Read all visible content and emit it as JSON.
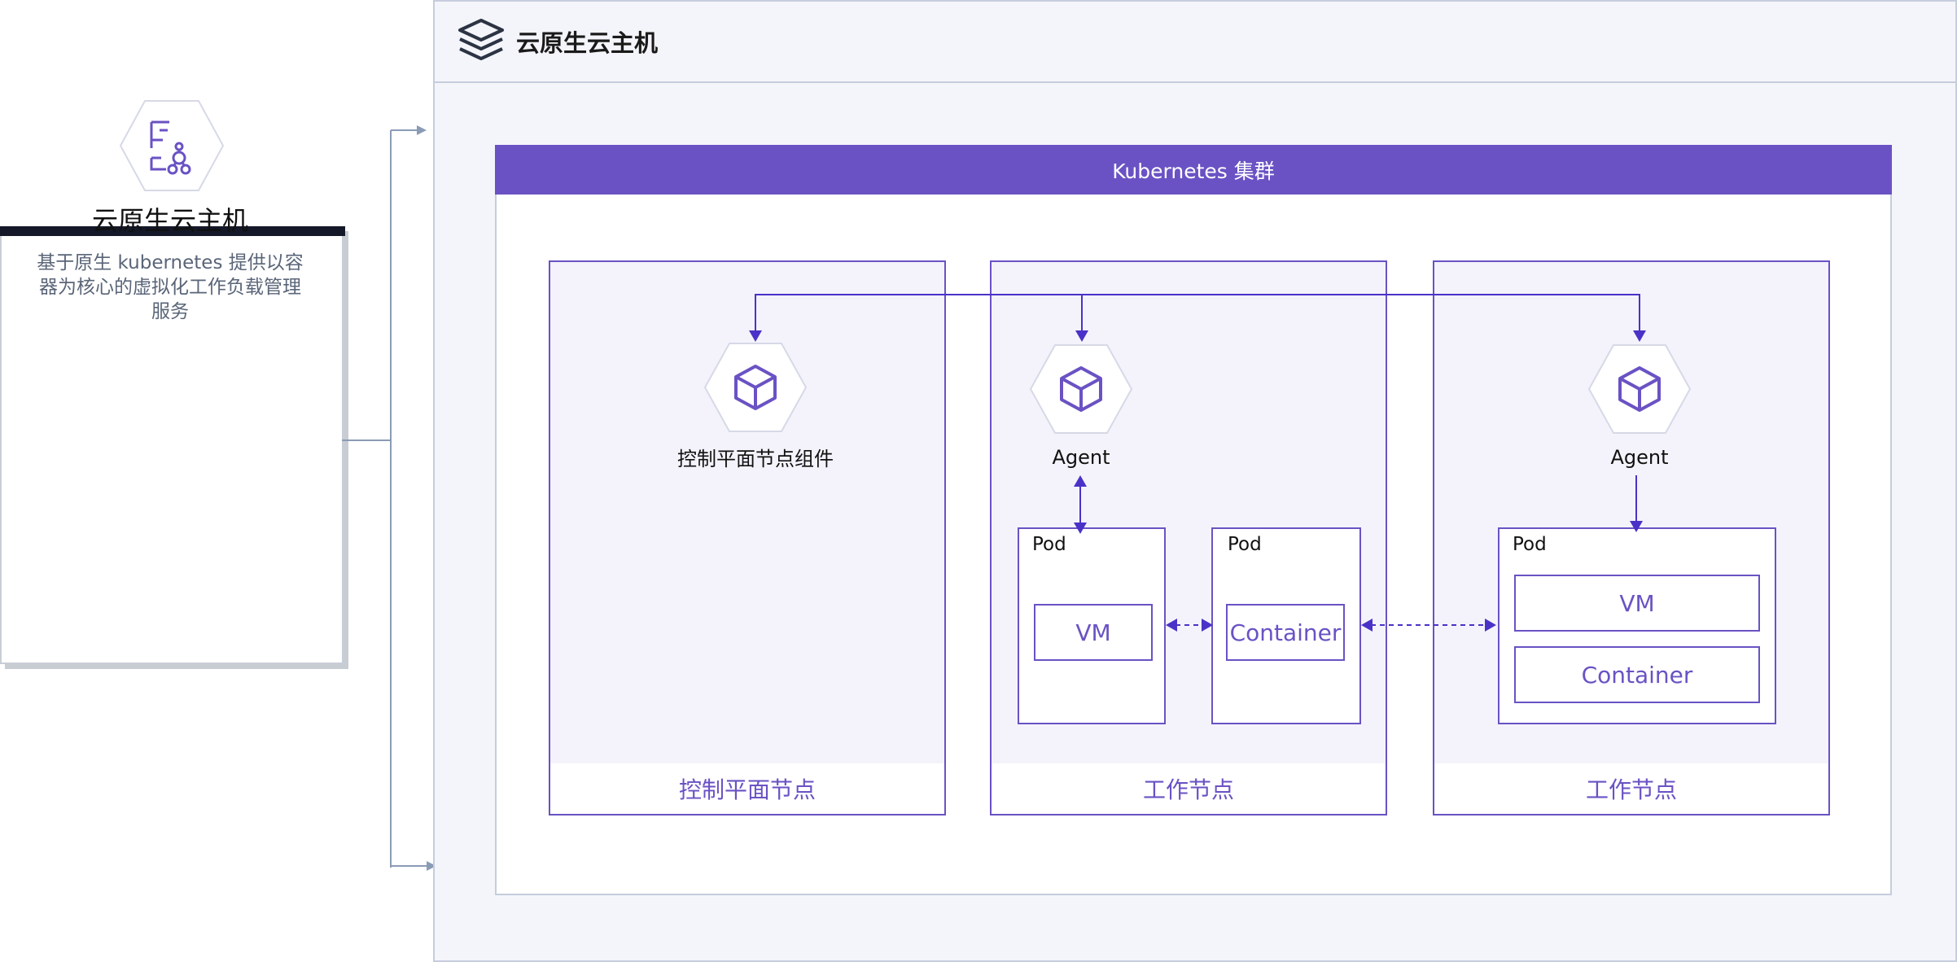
{
  "left_card": {
    "title": "云原生云主机",
    "description": "基于原生 kubernetes 提供以容器为核心的虚拟化工作负载管理服务"
  },
  "outer": {
    "title": "云原生云主机"
  },
  "cluster": {
    "title": "Kubernetes 集群"
  },
  "nodes": [
    {
      "label": "控制平面节点",
      "component": "控制平面节点组件"
    },
    {
      "label": "工作节点",
      "agent": "Agent"
    },
    {
      "label": "工作节点",
      "agent": "Agent"
    }
  ],
  "pods": {
    "worker1_pod1": {
      "label": "Pod",
      "item": "VM"
    },
    "worker1_pod2": {
      "label": "Pod",
      "item": "Container"
    },
    "worker2_pod": {
      "label": "Pod",
      "items": [
        "VM",
        "Container"
      ]
    }
  },
  "colors": {
    "accent": "#6a52c4",
    "border": "#c5cddd",
    "background": "#f4f5fa",
    "connector": "#8a9bb5"
  },
  "icons": [
    "layers-icon",
    "vm-cluster-icon",
    "cube-icon"
  ]
}
